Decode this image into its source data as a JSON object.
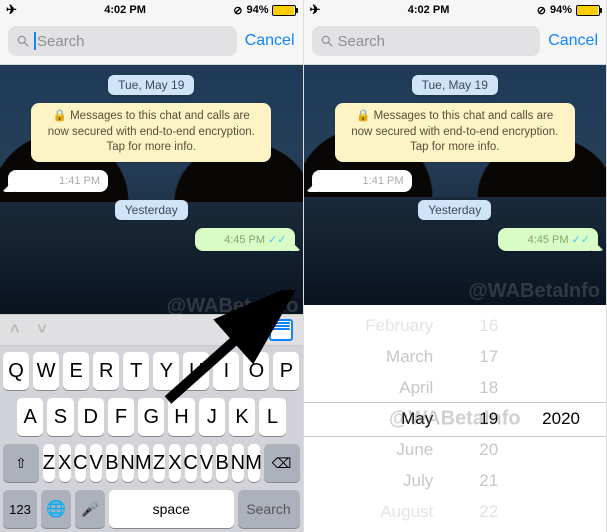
{
  "status": {
    "time": "4:02 PM",
    "battery_pct": "94%"
  },
  "search": {
    "placeholder": "Search",
    "cancel": "Cancel"
  },
  "chat": {
    "date_label": "Tue, May 19",
    "encryption_text": "Messages to this chat and calls are now secured with end-to-end encryption. Tap for more info.",
    "incoming_time": "1:41 PM",
    "yesterday_label": "Yesterday",
    "outgoing_time": "4:45 PM"
  },
  "watermark": "@WABetaInfo",
  "keyboard": {
    "row1": [
      "Q",
      "W",
      "E",
      "R",
      "T",
      "Y",
      "U",
      "I",
      "O",
      "P"
    ],
    "row2": [
      "A",
      "S",
      "D",
      "F",
      "G",
      "H",
      "J",
      "K",
      "L"
    ],
    "row3": [
      "Z",
      "X",
      "C",
      "V",
      "B",
      "N",
      "M"
    ],
    "num": "123",
    "space": "space",
    "search": "Search"
  },
  "picker": {
    "months": [
      "February",
      "March",
      "April",
      "May",
      "June",
      "July",
      "August"
    ],
    "days": [
      "16",
      "17",
      "18",
      "19",
      "20",
      "21",
      "22"
    ],
    "year": "2020",
    "selected_index": 3
  }
}
